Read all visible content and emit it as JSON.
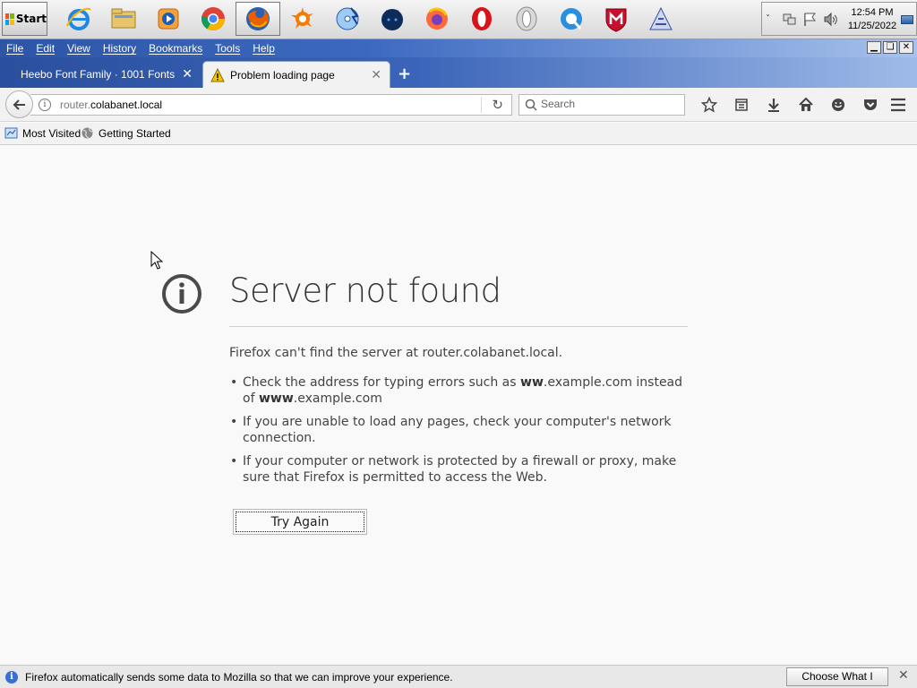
{
  "taskbar": {
    "start_label": "Start",
    "pinned": [
      {
        "name": "internet-explorer-icon",
        "active": false
      },
      {
        "name": "file-explorer-icon",
        "active": false
      },
      {
        "name": "media-player-icon",
        "active": false
      },
      {
        "name": "chrome-icon",
        "active": false
      },
      {
        "name": "firefox-icon",
        "active": true
      },
      {
        "name": "avast-icon",
        "active": false
      },
      {
        "name": "cd-burner-icon",
        "active": false
      },
      {
        "name": "waterfox-icon",
        "active": false
      },
      {
        "name": "firefox-alt-icon",
        "active": false
      },
      {
        "name": "opera-icon",
        "active": false
      },
      {
        "name": "opera-outline-icon",
        "active": false
      },
      {
        "name": "quicktime-icon",
        "active": false
      },
      {
        "name": "mcafee-icon",
        "active": false
      },
      {
        "name": "app-a-icon",
        "active": false
      }
    ],
    "clock_time": "12:54 PM",
    "clock_date": "11/25/2022"
  },
  "menubar": {
    "items": [
      "File",
      "Edit",
      "View",
      "History",
      "Bookmarks",
      "Tools",
      "Help"
    ]
  },
  "tabs": [
    {
      "label": "Heebo Font Family · 1001 Fonts",
      "active": false
    },
    {
      "label": "Problem loading page",
      "active": true
    }
  ],
  "navbar": {
    "url_prefix": "router.",
    "url_host": "colabanet.local",
    "search_placeholder": "Search"
  },
  "bookmarks": [
    {
      "label": "Most Visited",
      "icon": "most-visited-icon"
    },
    {
      "label": "Getting Started",
      "icon": "getting-started-icon"
    }
  ],
  "error_page": {
    "title": "Server not found",
    "description": "Firefox can't find the server at router.colabanet.local.",
    "tip1_a": "Check the address for typing errors such as ",
    "tip1_b": "ww",
    "tip1_c": ".example.com instead of ",
    "tip1_d": "www",
    "tip1_e": ".example.com",
    "tip2": "If you are unable to load any pages, check your computer's network connection.",
    "tip3": "If your computer or network is protected by a firewall or proxy, make sure that Firefox is permitted to access the Web.",
    "button_label": "Try Again"
  },
  "notification": {
    "text": "Firefox automatically sends some data to Mozilla so that we can improve your experience.",
    "button_label": "Choose What I Share"
  },
  "colors": {
    "menubar_blue": "#2d55a6",
    "firefox_orange": "#e66000",
    "warning_yellow": "#f5c400"
  }
}
